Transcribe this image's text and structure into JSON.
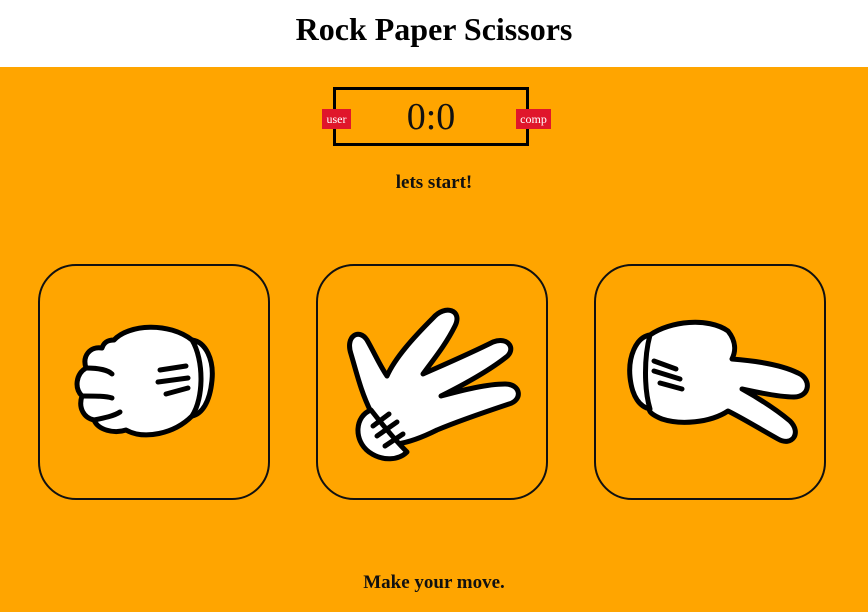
{
  "header": {
    "title": "Rock Paper Scissors"
  },
  "scoreboard": {
    "user_label": "user",
    "comp_label": "comp",
    "score": "0:0",
    "label_color": "#e0162b"
  },
  "result_text": "lets start!",
  "choices": [
    {
      "name": "rock",
      "icon": "rock-hand-icon"
    },
    {
      "name": "paper",
      "icon": "paper-hand-icon"
    },
    {
      "name": "scissors",
      "icon": "scissors-hand-icon"
    }
  ],
  "message": "Make your move.",
  "colors": {
    "background": "#ffa500",
    "header": "#ffffff",
    "glove": "#ffffff",
    "outline": "#000000"
  }
}
